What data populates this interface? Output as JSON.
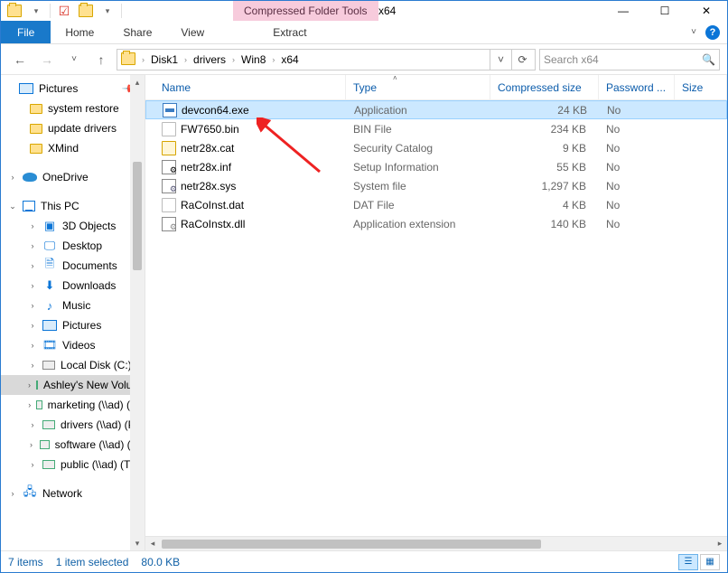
{
  "titlebar": {
    "tool_tab": "Compressed Folder Tools",
    "title": "x64"
  },
  "ribbon": {
    "file": "File",
    "tabs": [
      "Home",
      "Share",
      "View"
    ],
    "extract": "Extract"
  },
  "address": {
    "crumbs": [
      "Disk1",
      "drivers",
      "Win8",
      "x64"
    ],
    "search_placeholder": "Search x64"
  },
  "nav": {
    "quick": {
      "pinned": "Pictures",
      "items": [
        "system restore",
        "update drivers",
        "XMind"
      ]
    },
    "onedrive": "OneDrive",
    "thispc": "This PC",
    "pc_items": [
      "3D Objects",
      "Desktop",
      "Documents",
      "Downloads",
      "Music",
      "Pictures",
      "Videos",
      "Local Disk (C:)",
      "Ashley's New Volume (D:)",
      "marketing (\\\\ad) (N:)",
      "drivers (\\\\ad) (P:)",
      "software (\\\\ad) (S:)",
      "public (\\\\ad) (T:)"
    ],
    "network": "Network"
  },
  "columns": {
    "name": "Name",
    "type": "Type",
    "size": "Compressed size",
    "pwd": "Password ...",
    "sz2": "Size"
  },
  "files": [
    {
      "name": "devcon64.exe",
      "type": "Application",
      "size": "24 KB",
      "pwd": "No",
      "ico": "exe",
      "selected": true
    },
    {
      "name": "FW7650.bin",
      "type": "BIN File",
      "size": "234 KB",
      "pwd": "No",
      "ico": "blank"
    },
    {
      "name": "netr28x.cat",
      "type": "Security Catalog",
      "size": "9 KB",
      "pwd": "No",
      "ico": "cat"
    },
    {
      "name": "netr28x.inf",
      "type": "Setup Information",
      "size": "55 KB",
      "pwd": "No",
      "ico": "inf"
    },
    {
      "name": "netr28x.sys",
      "type": "System file",
      "size": "1,297 KB",
      "pwd": "No",
      "ico": "sys"
    },
    {
      "name": "RaCoInst.dat",
      "type": "DAT File",
      "size": "4 KB",
      "pwd": "No",
      "ico": "blank"
    },
    {
      "name": "RaCoInstx.dll",
      "type": "Application extension",
      "size": "140 KB",
      "pwd": "No",
      "ico": "dll"
    }
  ],
  "status": {
    "count": "7 items",
    "selected": "1 item selected",
    "size": "80.0 KB"
  }
}
